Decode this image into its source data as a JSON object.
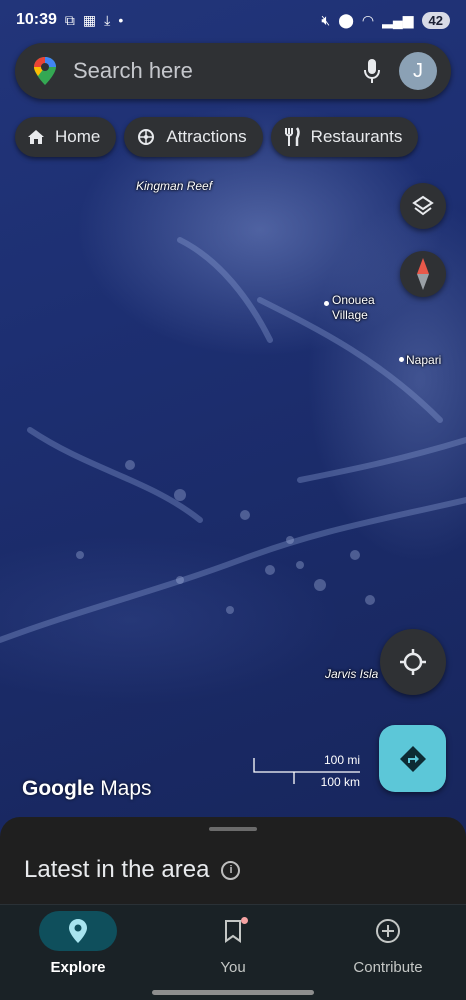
{
  "status_bar": {
    "time": "10:39",
    "battery": "42"
  },
  "search": {
    "placeholder": "Search here",
    "avatar_initial": "J"
  },
  "chips": [
    {
      "label": "Home",
      "icon": "home-icon"
    },
    {
      "label": "Attractions",
      "icon": "attractions-icon"
    },
    {
      "label": "Restaurants",
      "icon": "restaurants-icon"
    }
  ],
  "map": {
    "places": [
      {
        "name": "Kingman Reef"
      },
      {
        "name": "Onouea\nVillage"
      },
      {
        "name": "Napari"
      },
      {
        "name": "Jarvis Isla"
      }
    ],
    "scale": {
      "imperial": "100 mi",
      "metric": "100 km"
    },
    "watermark_brand": "Google",
    "watermark_product": "Maps"
  },
  "sheet": {
    "title": "Latest in the area"
  },
  "nav": {
    "items": [
      {
        "label": "Explore",
        "active": true
      },
      {
        "label": "You",
        "active": false
      },
      {
        "label": "Contribute",
        "active": false
      }
    ]
  },
  "colors": {
    "accent": "#5cc7d8",
    "active_nav_pill": "#0f4f5c",
    "surface": "#2f3134"
  }
}
